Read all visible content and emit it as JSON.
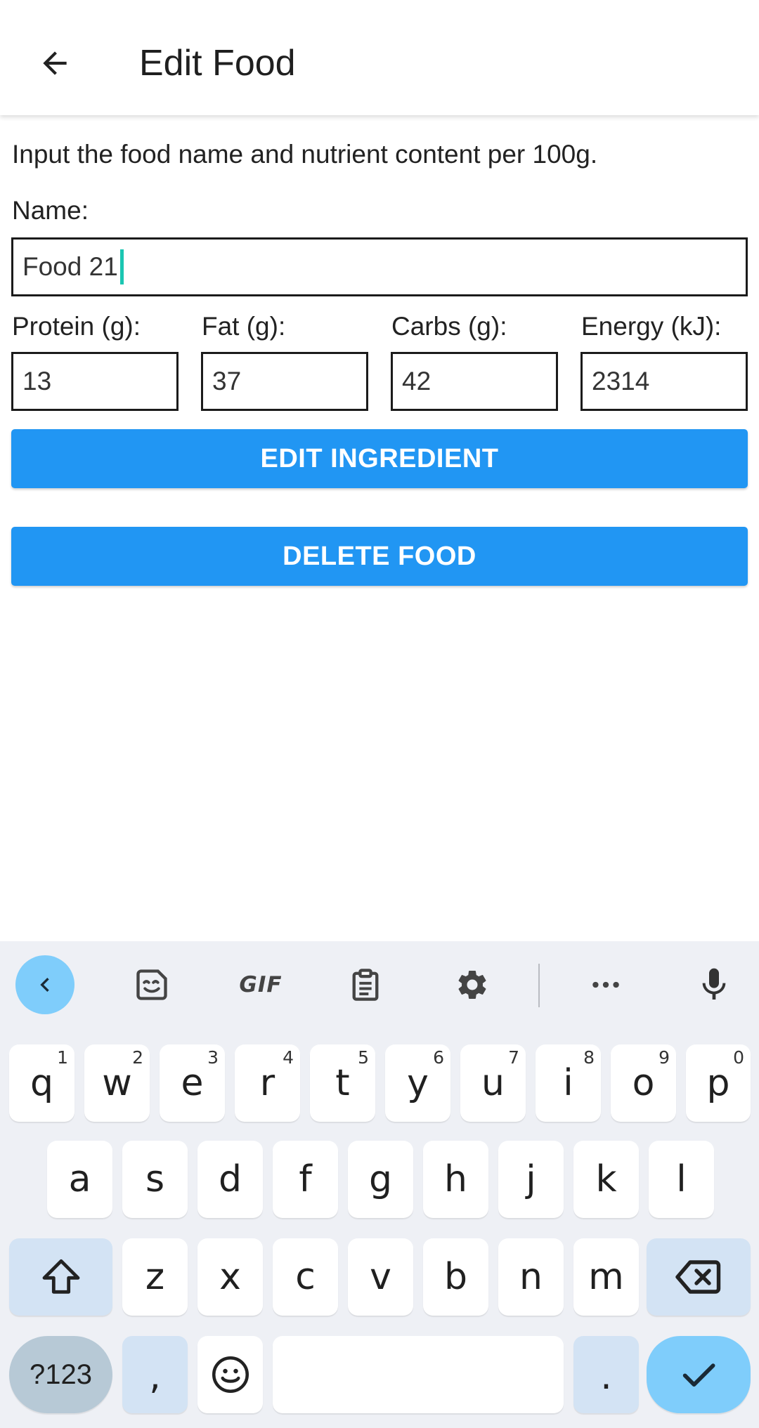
{
  "app_bar": {
    "title": "Edit Food",
    "back_icon": "arrow-back-icon"
  },
  "form": {
    "instructions": "Input the food name and nutrient content per 100g.",
    "name_label": "Name:",
    "name_value": "Food 21",
    "nutrients": [
      {
        "label": "Protein (g):",
        "value": "13"
      },
      {
        "label": "Fat (g):",
        "value": "37"
      },
      {
        "label": "Carbs (g):",
        "value": "42"
      },
      {
        "label": "Energy (kJ):",
        "value": "2314"
      }
    ],
    "edit_button": "EDIT INGREDIENT",
    "delete_button": "DELETE FOOD"
  },
  "keyboard": {
    "toolbar": {
      "collapse_icon": "chevron-left-icon",
      "sticker_icon": "sticker-icon",
      "gif_label": "GIF",
      "clipboard_icon": "clipboard-icon",
      "settings_icon": "gear-icon",
      "more_icon": "more-horizontal-icon",
      "mic_icon": "microphone-icon"
    },
    "row1": [
      {
        "key": "q",
        "hint": "1"
      },
      {
        "key": "w",
        "hint": "2"
      },
      {
        "key": "e",
        "hint": "3"
      },
      {
        "key": "r",
        "hint": "4"
      },
      {
        "key": "t",
        "hint": "5"
      },
      {
        "key": "y",
        "hint": "6"
      },
      {
        "key": "u",
        "hint": "7"
      },
      {
        "key": "i",
        "hint": "8"
      },
      {
        "key": "o",
        "hint": "9"
      },
      {
        "key": "p",
        "hint": "0"
      }
    ],
    "row2": [
      "a",
      "s",
      "d",
      "f",
      "g",
      "h",
      "j",
      "k",
      "l"
    ],
    "row3": [
      "z",
      "x",
      "c",
      "v",
      "b",
      "n",
      "m"
    ],
    "symbols_key": "?123",
    "comma_key": ",",
    "period_key": ".",
    "colors": {
      "accent": "#2196f3",
      "keyboard_bg": "#eef0f5",
      "special_key": "#d3e3f4",
      "enter_key": "#7fcdfb",
      "caret": "#1bc6b2"
    }
  }
}
